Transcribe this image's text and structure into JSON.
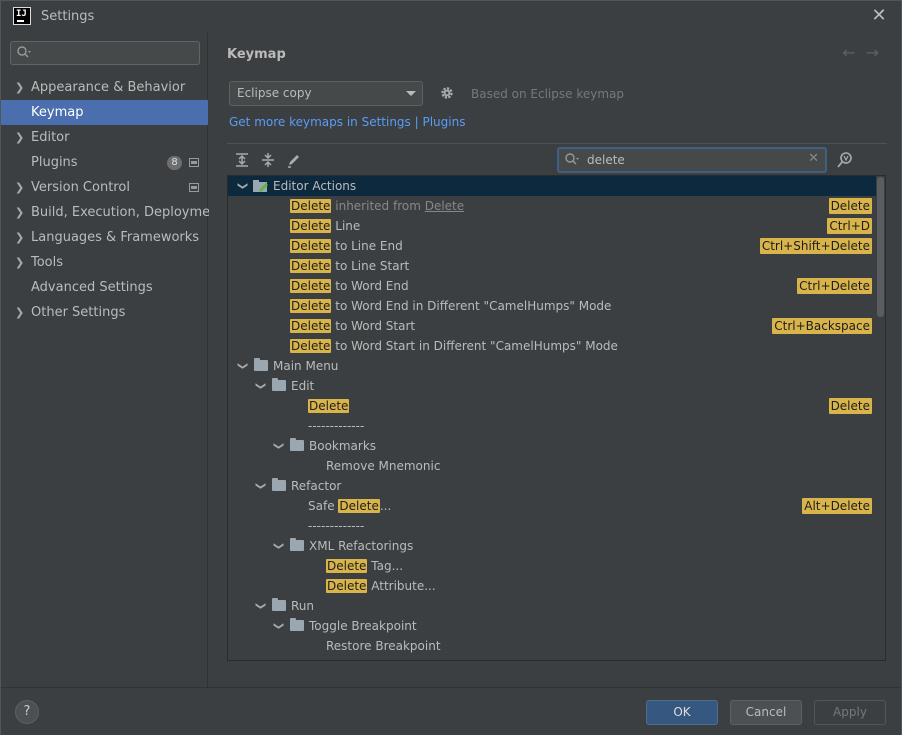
{
  "window": {
    "title": "Settings",
    "logo": "IJ"
  },
  "sidebar": {
    "search_placeholder": "",
    "items": [
      {
        "label": "Appearance & Behavior",
        "expandable": true
      },
      {
        "label": "Keymap",
        "selected": true
      },
      {
        "label": "Editor",
        "expandable": true
      },
      {
        "label": "Plugins",
        "badge": "8"
      },
      {
        "label": "Version Control",
        "expandable": true
      },
      {
        "label": "Build, Execution, Deployment",
        "expandable": true
      },
      {
        "label": "Languages & Frameworks",
        "expandable": true
      },
      {
        "label": "Tools",
        "expandable": true
      },
      {
        "label": "Advanced Settings"
      },
      {
        "label": "Other Settings",
        "expandable": true
      }
    ]
  },
  "main": {
    "title": "Keymap",
    "keymap_value": "Eclipse copy",
    "based_on": "Based on Eclipse keymap",
    "more_link": "Get more keymaps in Settings | Plugins",
    "search_value": "delete"
  },
  "tree": {
    "editor_actions": "Editor Actions",
    "r1_hl": "Delete",
    "r1_a": " inherited from ",
    "r1_b": "Delete",
    "r1_sc": "Delete",
    "r2_hl": "Delete",
    "r2_t": " Line",
    "r2_sc": "Ctrl+D",
    "r3_hl": "Delete",
    "r3_t": " to Line End",
    "r3_sc": "Ctrl+Shift+Delete",
    "r4_hl": "Delete",
    "r4_t": " to Line Start",
    "r5_hl": "Delete",
    "r5_t": " to Word End",
    "r5_sc": "Ctrl+Delete",
    "r6_hl": "Delete",
    "r6_t": " to Word End in Different \"CamelHumps\" Mode",
    "r7_hl": "Delete",
    "r7_t": " to Word Start",
    "r7_sc": "Ctrl+Backspace",
    "r8_hl": "Delete",
    "r8_t": " to Word Start in Different \"CamelHumps\" Mode",
    "main_menu": "Main Menu",
    "edit": "Edit",
    "edit_delete_hl": "Delete",
    "edit_delete_sc": "Delete",
    "separator1": "-------------",
    "bookmarks": "Bookmarks",
    "remove_mnemonic": "Remove Mnemonic",
    "refactor": "Refactor",
    "safe_pre": "Safe ",
    "safe_hl": "Delete",
    "safe_post": "...",
    "safe_sc": "Alt+Delete",
    "separator2": "-------------",
    "xml_refactorings": "XML Refactorings",
    "tag_hl": "Delete",
    "tag_post": " Tag...",
    "attr_hl": "Delete",
    "attr_post": " Attribute...",
    "run": "Run",
    "toggle_breakpoint": "Toggle Breakpoint",
    "restore_breakpoint": "Restore Breakpoint"
  },
  "footer": {
    "help": "?",
    "ok": "OK",
    "cancel": "Cancel",
    "apply": "Apply"
  },
  "colors": {
    "accent": "#4b6eaf",
    "highlight": "#d8b44a",
    "link": "#589df6",
    "ok_button": "#365880"
  }
}
